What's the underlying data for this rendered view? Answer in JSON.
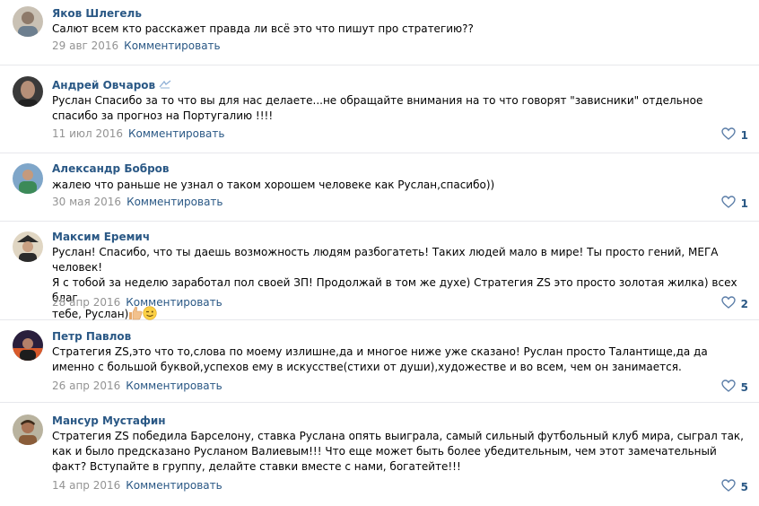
{
  "comments": [
    {
      "author": "Яков Шлегель",
      "text": "Салют всем кто расскажет правда ли всё это что пишут про стратегию??",
      "date": "29 авг 2016",
      "reply_label": "Комментировать",
      "likes": "",
      "avatar_colors": [
        "#6d7f8f",
        "#c9c1b4"
      ]
    },
    {
      "author": "Андрей Овчаров",
      "text": "Руслан Спасибо за то что вы для нас делаете...не обращайте внимания на то что говорят \"зависники\" отдельное спасибо за прогноз на Португалию !!!!",
      "date": "11 июл 2016",
      "reply_label": "Комментировать",
      "likes": "1",
      "avatar_colors": [
        "#3a3a3a",
        "#b58f78"
      ]
    },
    {
      "author": "Александр Бобров",
      "text": "жалею что раньше не узнал о таком хорошем человеке как Руслан,спасибо))",
      "date": "30 мая 2016",
      "reply_label": "Комментировать",
      "likes": "1",
      "avatar_colors": [
        "#7fa6c9",
        "#3c8a58"
      ]
    },
    {
      "author": "Максим Еремич",
      "text_lines": [
        "Руслан! Спасибо, что ты даешь возможность людям разбогатеть! Таких людей мало в мире! Ты просто гений, МЕГА человек!",
        "Я с тобой за неделю заработал пол своей ЗП! Продолжай в том же духе) Стратегия ZS это просто золотая жилка) всех благ",
        "тебе, Руслан)"
      ],
      "date": "28 апр 2016",
      "reply_label": "Комментировать",
      "likes": "2",
      "avatar_colors": [
        "#2b2b2b",
        "#e0d6c3"
      ]
    },
    {
      "author": "Петр Павлов",
      "text": "Стратегия ZS,это что то,слова по моему излишне,да и многое ниже уже сказано! Руслан просто Талантище,да да именно с большой буквой,успехов ему в искусстве(стихи от души),художестве и во всем, чем он занимается.",
      "date": "26 апр 2016",
      "reply_label": "Комментировать",
      "likes": "5",
      "avatar_colors": [
        "#2a1f3d",
        "#d95a2b"
      ]
    },
    {
      "author": "Мансур Мустафин",
      "text": "Стратегия ZS победила Барселону, ставка Руслана опять выиграла, самый сильный футбольный клуб мира, сыграл так, как и было предсказано Русланом Валиевым!!! Что еще может быть более убедительным, чем этот замечательный факт? Вступайте в группу, делайте ставки вместе с нами, богатейте!!!",
      "date": "14 апр 2016",
      "reply_label": "Комментировать",
      "likes": "5",
      "avatar_colors": [
        "#b9b39f",
        "#8a5d3a"
      ]
    }
  ],
  "icons": {
    "like": "heart-outline-icon",
    "thumbs_up": "thumbs-up-emoji",
    "wink": "wink-emoji"
  },
  "colors": {
    "link": "#2a5885",
    "meta": "#939393",
    "divider": "#e7e8ec"
  }
}
